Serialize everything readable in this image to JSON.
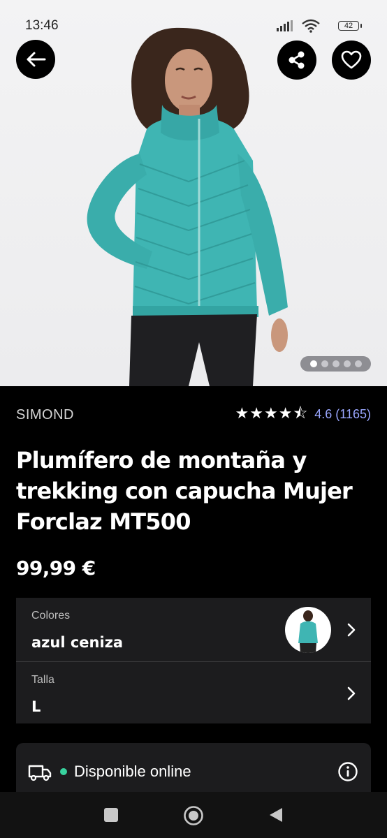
{
  "status_bar": {
    "time": "13:46",
    "battery": "42"
  },
  "header": {
    "back_icon": "arrow-left-icon",
    "share_icon": "share-icon",
    "favorite_icon": "heart-icon"
  },
  "gallery": {
    "image_count": 5,
    "active_index": 0
  },
  "product": {
    "brand": "SIMOND",
    "rating_value": 4.5,
    "rating_text": "4.6 (1165)",
    "title": "Plumífero de montaña y trekking con capucha Mujer Forclaz MT500",
    "price": "99,99 €"
  },
  "options": {
    "colors_label": "Colores",
    "colors_value": "azul ceniza",
    "size_label": "Talla",
    "size_value": "L"
  },
  "availability": {
    "text": "Disponible online",
    "status_color": "#38d39f"
  },
  "colors": {
    "jacket": "#3fb5b3",
    "accent_link": "#9aa7ff"
  }
}
